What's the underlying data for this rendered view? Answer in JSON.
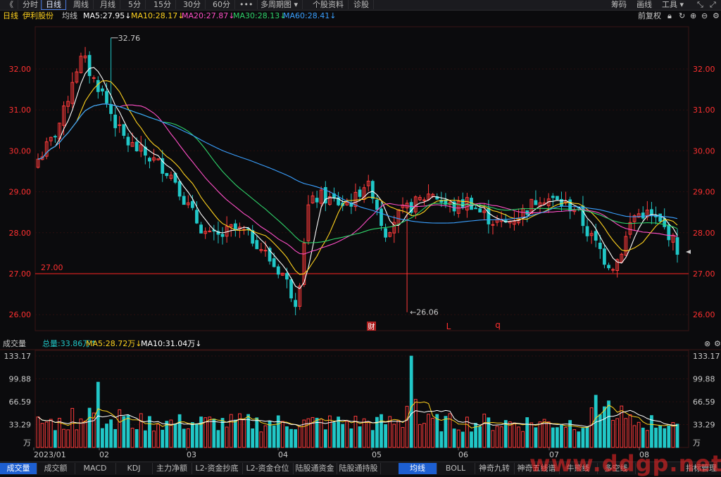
{
  "toolbar": {
    "back": "《",
    "periods": [
      "分时",
      "日线",
      "周线",
      "月线",
      "5分",
      "15分",
      "30分",
      "60分",
      "•••",
      "多周期图 ▾",
      "个股资料",
      "诊股"
    ],
    "active_period": "日线",
    "right_items": [
      "筹码",
      "画线",
      "工具 ▾"
    ]
  },
  "header": {
    "period": "日线",
    "stock": "伊利股份",
    "ma_label": "均线",
    "ma5": "MA5:27.95↓",
    "ma10": "MA10:28.17↓",
    "ma20": "MA20:27.87↓",
    "ma30": "MA30:28.13↓",
    "ma60": "MA60:28.41↓",
    "adjust": "前复权"
  },
  "volume_header": {
    "title": "成交量",
    "total": "总量:33.86万↑",
    "ma5": "MA5:28.72万↓",
    "ma10": "MA10:31.04万↓"
  },
  "colors": {
    "up": "#ff3b3b",
    "down": "#21c7c7",
    "ma5": "#ffffff",
    "ma10": "#ffd21e",
    "ma20": "#ff4fc6",
    "ma30": "#2fd36a",
    "ma60": "#3aa0ff",
    "axis_red": "#ff3030",
    "grid": "#2a0f0f"
  },
  "chart_data": [
    {
      "type": "candlestick",
      "title": "伊利股份 日线",
      "ylim": [
        25.8,
        33.0
      ],
      "y_ticks": [
        "32.00",
        "31.00",
        "30.00",
        "29.00",
        "28.00",
        "27.00",
        "26.00"
      ],
      "reference_line": {
        "value": 27.0,
        "label": "27.00"
      },
      "annotations": [
        {
          "label": "32.76",
          "value": 32.76
        },
        {
          "label": "←26.06",
          "value": 26.06
        }
      ],
      "event_markers": [
        "财",
        "L",
        "q"
      ],
      "x_ticks": [
        "2023/01",
        "02",
        "03",
        "04",
        "05",
        "06",
        "07",
        "08"
      ],
      "series_names": [
        "MA5",
        "MA10",
        "MA20",
        "MA30",
        "MA60"
      ],
      "ma_key_values": {
        "MA5": 27.95,
        "MA10": 28.17,
        "MA20": 27.87,
        "MA30": 28.13,
        "MA60": 28.41
      }
    },
    {
      "type": "bar",
      "title": "成交量",
      "unit": "万",
      "ylim": [
        0,
        133.17
      ],
      "y_ticks": [
        "133.17",
        "99.88",
        "66.59",
        "33.29",
        "万"
      ],
      "latest_total": 33.86,
      "ma5": 28.72,
      "ma10": 31.04
    }
  ],
  "bottom_tabs_left": [
    "成交量",
    "成交额",
    "MACD",
    "KDJ",
    "主力净额",
    "L2-资金抄底",
    "L2-资金仓位",
    "陆股通资金",
    "陆股通持股"
  ],
  "bottom_tabs_right": [
    "均线",
    "BOLL",
    "神奇九转",
    "神奇五线谱",
    "牛熊线",
    "多空线",
    "指标管理"
  ],
  "watermark": "www.ddgp.net"
}
